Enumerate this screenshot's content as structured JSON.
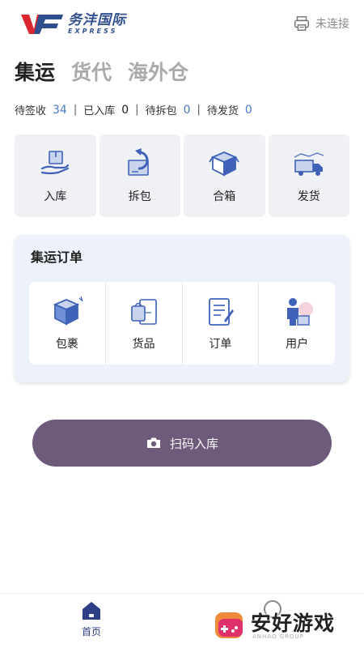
{
  "header": {
    "brand_cn": "务沣国际",
    "brand_en": "EXPRESS",
    "printer_status": "未连接",
    "printer_icon": "printer-icon"
  },
  "tabs": [
    {
      "label": "集运",
      "active": true
    },
    {
      "label": "货代",
      "active": false
    },
    {
      "label": "海外仓",
      "active": false
    }
  ],
  "stats": [
    {
      "label": "待签收",
      "value": "34"
    },
    {
      "label": "已入库",
      "value": "0"
    },
    {
      "label": "待拆包",
      "value": "0"
    },
    {
      "label": "待发货",
      "value": "0"
    }
  ],
  "quick_actions": [
    {
      "label": "入库",
      "icon": "inbound-box-icon"
    },
    {
      "label": "拆包",
      "icon": "unpack-icon"
    },
    {
      "label": "合箱",
      "icon": "merge-box-icon"
    },
    {
      "label": "发货",
      "icon": "delivery-truck-icon"
    }
  ],
  "order_panel": {
    "title": "集运订单",
    "items": [
      {
        "label": "包裹",
        "icon": "parcel-icon"
      },
      {
        "label": "货品",
        "icon": "goods-bag-icon"
      },
      {
        "label": "订单",
        "icon": "order-document-icon"
      },
      {
        "label": "用户",
        "icon": "user-icon"
      }
    ]
  },
  "scan_button": {
    "label": "扫码入库",
    "icon": "camera-icon"
  },
  "bottom_nav": {
    "home_label": "首页"
  },
  "watermark": {
    "text": "安好游戏",
    "sub": "ANHAO GROUP"
  },
  "colors": {
    "brand_blue": "#2f4f8f",
    "accent_blue": "#4a7ac9",
    "scan_button": "#6e5a7b",
    "panel_bg": "#edf1f9",
    "card_bg": "#f0f1f5"
  }
}
